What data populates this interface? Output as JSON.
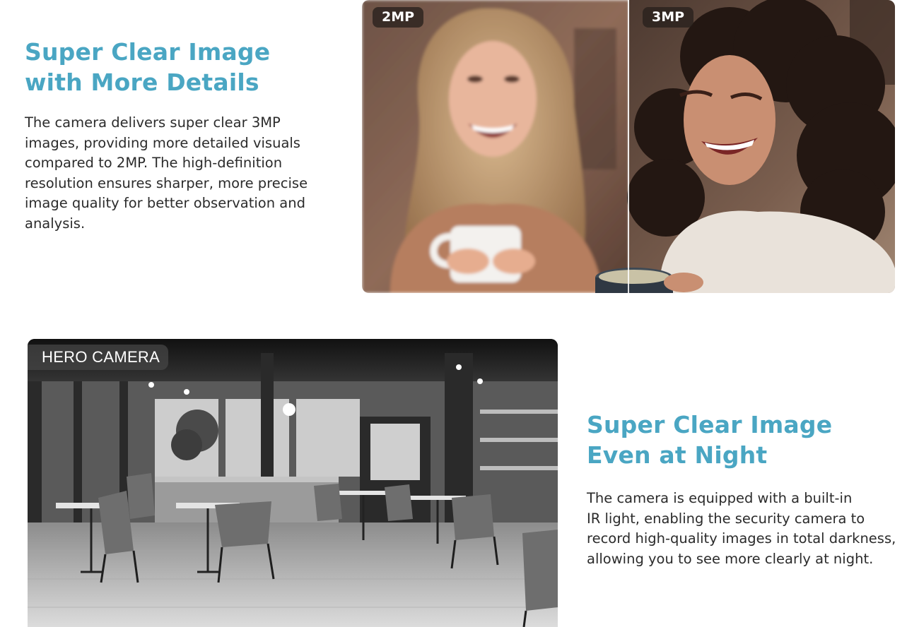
{
  "section_top": {
    "heading_lines": [
      "Super Clear Image",
      "with More Details"
    ],
    "body_lines": [
      "The camera delivers super clear 3MP",
      "images, providing more detailed visuals",
      "compared to 2MP. The high-definition",
      "resolution ensures sharper, more precise",
      "image quality for better observation and",
      "analysis."
    ],
    "left_badge": "2MP",
    "right_badge": "3MP"
  },
  "section_bottom": {
    "image_label": "HERO CAMERA",
    "heading_lines": [
      "Super Clear Image",
      "Even at Night"
    ],
    "body_lines": [
      "The camera is equipped with a built-in",
      "IR light, enabling the security camera to",
      "record high-quality images in total darkness,",
      "allowing you to see more clearly at night."
    ]
  },
  "colors": {
    "heading": "#4aa6c3",
    "body_text": "#2b2b2b"
  }
}
